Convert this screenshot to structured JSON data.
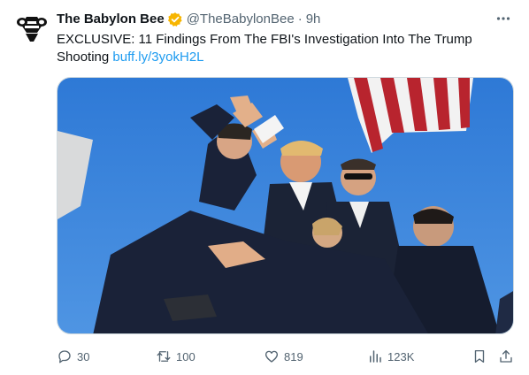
{
  "tweet": {
    "author_name": "The Babylon Bee",
    "handle": "@TheBabylonBee",
    "separator": "·",
    "time": "9h",
    "text": "EXCLUSIVE: 11 Findings From The FBI's Investigation Into The Trump Shooting",
    "link": "buff.ly/3yokH2L"
  },
  "actions": {
    "replies": "30",
    "retweets": "100",
    "likes": "819",
    "views": "123K"
  },
  "colors": {
    "verified_badge": "#f7b500",
    "link": "#1d9bf0",
    "muted": "#536471",
    "sky": "#2f7ad8"
  },
  "icons": {
    "avatar": "bee-logo-icon",
    "verified": "verified-gold-badge-icon",
    "more": "more-horizontal-icon",
    "reply": "reply-icon",
    "retweet": "retweet-icon",
    "like": "heart-icon",
    "views": "views-chart-icon",
    "bookmark": "bookmark-icon",
    "share": "share-icon"
  }
}
